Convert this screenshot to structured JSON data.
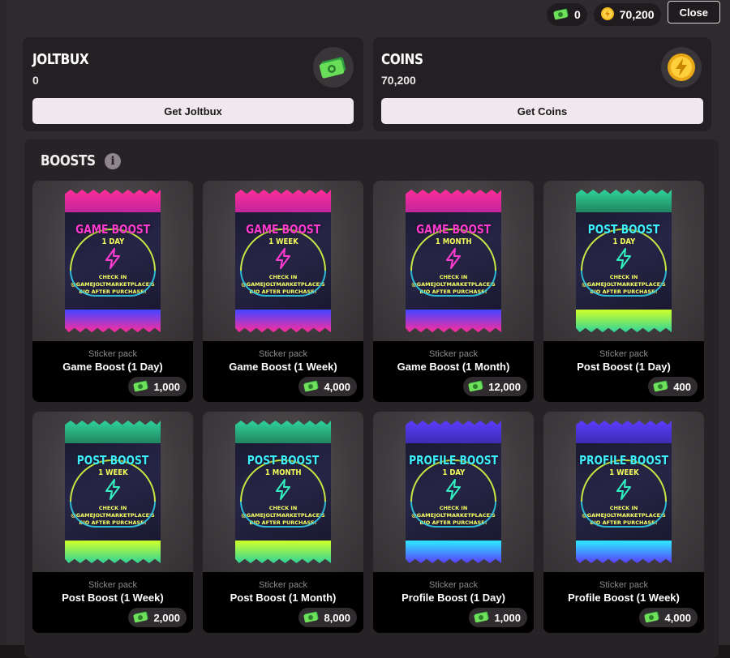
{
  "topbar": {
    "joltbux": "0",
    "coins": "70,200",
    "close_label": "Close"
  },
  "wallets": {
    "joltbux": {
      "title": "JOLTBUX",
      "value": "0",
      "button": "Get Joltbux",
      "icon": "joltbux-icon"
    },
    "coins": {
      "title": "COINS",
      "value": "70,200",
      "button": "Get Coins",
      "icon": "coin-icon"
    }
  },
  "boosts": {
    "title": "BOOSTS",
    "info_icon": "i",
    "pack_check_text": [
      "CHECK IN",
      "@GAMEJOLTMARKETPLACE'S",
      "BIO AFTER PURCHASE!"
    ],
    "items": [
      {
        "type": "Sticker pack",
        "name": "Game Boost (1 Day)",
        "price": "1,000",
        "pack_title": "GAME BOOST",
        "pack_duration": "1 DAY",
        "colors": [
          "#ff2d9a",
          "#b9249c",
          "#4b44ff",
          "#ff2d9a"
        ]
      },
      {
        "type": "Sticker pack",
        "name": "Game Boost (1 Week)",
        "price": "4,000",
        "pack_title": "GAME BOOST",
        "pack_duration": "1 WEEK",
        "colors": [
          "#ff2d9a",
          "#b9249c",
          "#4b44ff",
          "#ff2d9a"
        ]
      },
      {
        "type": "Sticker pack",
        "name": "Game Boost (1 Month)",
        "price": "12,000",
        "pack_title": "GAME BOOST",
        "pack_duration": "1 MONTH",
        "colors": [
          "#ff2d9a",
          "#b9249c",
          "#4b44ff",
          "#ff2d9a"
        ]
      },
      {
        "type": "Sticker pack",
        "name": "Post Boost (1 Day)",
        "price": "400",
        "pack_title": "POST BOOST",
        "pack_duration": "1 DAY",
        "colors": [
          "#2fd39a",
          "#1f7a5a",
          "#c8ff2f",
          "#2fd39a"
        ]
      },
      {
        "type": "Sticker pack",
        "name": "Post Boost (1 Week)",
        "price": "2,000",
        "pack_title": "POST BOOST",
        "pack_duration": "1 WEEK",
        "colors": [
          "#2fd39a",
          "#1f7a5a",
          "#c8ff2f",
          "#2fd39a"
        ]
      },
      {
        "type": "Sticker pack",
        "name": "Post Boost (1 Month)",
        "price": "8,000",
        "pack_title": "POST BOOST",
        "pack_duration": "1 MONTH",
        "colors": [
          "#2fd39a",
          "#1f7a5a",
          "#c8ff2f",
          "#2fd39a"
        ]
      },
      {
        "type": "Sticker pack",
        "name": "Profile Boost (1 Day)",
        "price": "1,000",
        "pack_title": "PROFILE BOOST",
        "pack_duration": "1 DAY",
        "colors": [
          "#5a3cff",
          "#3b2aa8",
          "#2fe3ff",
          "#5a3cff"
        ]
      },
      {
        "type": "Sticker pack",
        "name": "Profile Boost (1 Week)",
        "price": "4,000",
        "pack_title": "PROFILE BOOST",
        "pack_duration": "1 WEEK",
        "colors": [
          "#5a3cff",
          "#3b2aa8",
          "#2fe3ff",
          "#5a3cff"
        ]
      }
    ]
  },
  "colors": {
    "modal_bg": "#2f2a2d",
    "card_bg": "#231f22",
    "button_bg": "#efe9ee",
    "title_cyan": "#3ff0ff",
    "title_yellow": "#f4ff5a",
    "bolt_pink": "#ff3bd0",
    "bolt_green": "#33f0c0"
  }
}
